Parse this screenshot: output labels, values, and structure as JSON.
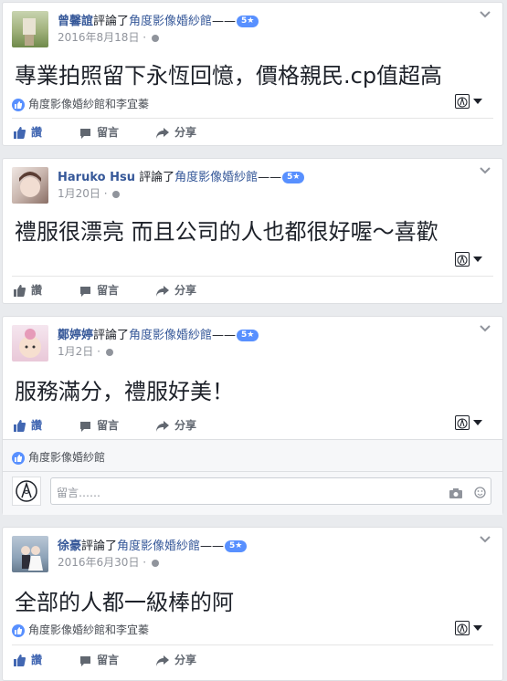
{
  "posts": [
    {
      "name": "曾馨誼",
      "verb": "評論了",
      "page": "角度影像婚紗館",
      "dash": "——",
      "badge": "5★",
      "date": "2016年8月18日",
      "text": "專業拍照留下永恆回憶，價格親民.cp值超高",
      "likes_label": "角度影像婚紗館和李宜蓁",
      "actions": {
        "like": "讚",
        "comment": "留言",
        "share": "分享"
      }
    },
    {
      "name": "Haruko Hsu",
      "verb": "評論了",
      "page": "角度影像婚紗館",
      "dash": "——",
      "badge": "5★",
      "date": "1月20日",
      "text": "禮服很漂亮 而且公司的人也都很好喔～喜歡",
      "actions": {
        "like": "讚",
        "comment": "留言",
        "share": "分享"
      }
    },
    {
      "name": "鄭婷婷",
      "verb": "評論了",
      "page": "角度影像婚紗館",
      "dash": "——",
      "badge": "5★",
      "date": "1月2日",
      "text": "服務滿分，禮服好美！",
      "likes_label": "角度影像婚紗館",
      "comment_placeholder": "留言……",
      "actions": {
        "like": "讚",
        "comment": "留言",
        "share": "分享"
      }
    },
    {
      "name": "徐豪",
      "verb": "評論了",
      "page": "角度影像婚紗館",
      "dash": "——",
      "badge": "5★",
      "date": "2016年6月30日",
      "text": "全部的人都一級棒的阿",
      "likes_label": "角度影像婚紗館和李宜蓁",
      "actions": {
        "like": "讚",
        "comment": "留言",
        "share": "分享"
      }
    }
  ],
  "colors": {
    "link": "#365899",
    "accent": "#4267b2",
    "badge": "#5890ff",
    "bg": "#e9ebee"
  },
  "icons": {
    "like": "thumbs-up-icon",
    "comment": "speech-bubble-icon",
    "share": "share-arrow-icon",
    "privacy": "globe-icon",
    "menu": "chevron-down-icon",
    "camera": "camera-icon",
    "emoji": "smiley-icon"
  }
}
